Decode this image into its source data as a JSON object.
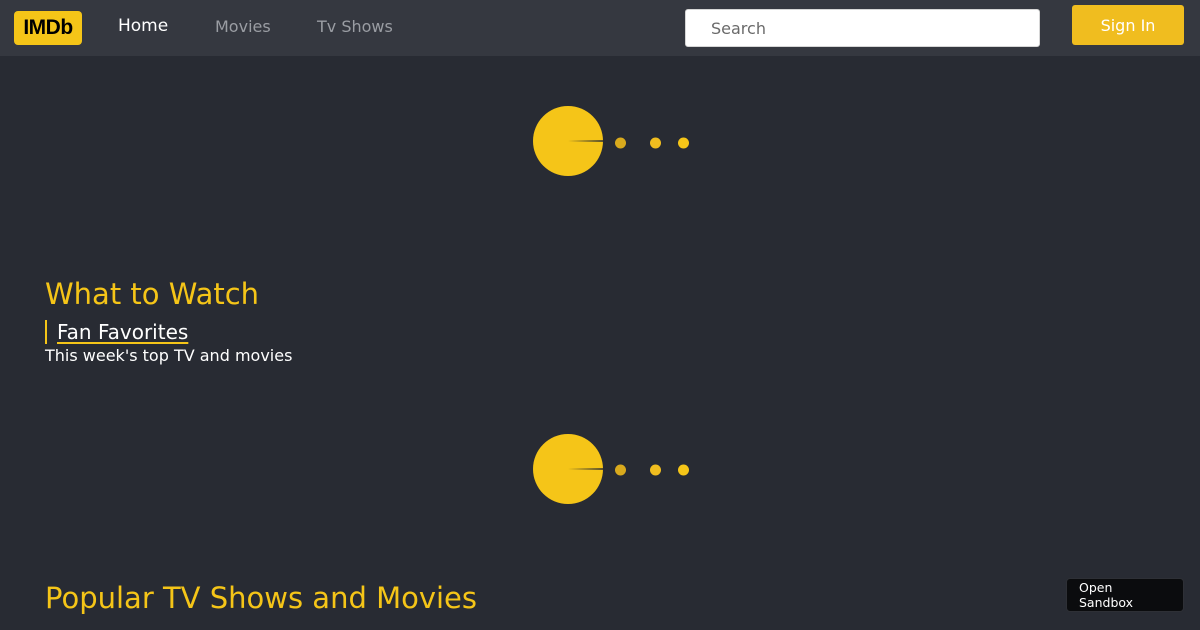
{
  "header": {
    "logo_text": "IMDb",
    "nav": [
      {
        "label": "Home",
        "active": true
      },
      {
        "label": "Movies",
        "active": false
      },
      {
        "label": "Tv Shows",
        "active": false
      }
    ],
    "search_placeholder": "Search",
    "sign_in_label": "Sign In"
  },
  "sections": {
    "what_to_watch": {
      "title": "What to Watch",
      "fan_favorites_label": "Fan Favorites",
      "subtitle": "This week's top TV and movies"
    },
    "popular": {
      "title": "Popular TV Shows and Movies"
    }
  },
  "loaders": [
    {
      "icon": "pacman-loader-icon"
    },
    {
      "icon": "pacman-loader-icon"
    }
  ],
  "sandbox_badge": {
    "line1": "Open",
    "line2": "Sandbox"
  },
  "colors": {
    "background": "#282b33",
    "header": "#353840",
    "accent": "#f5c518",
    "sign_in": "#f0bd1f"
  }
}
